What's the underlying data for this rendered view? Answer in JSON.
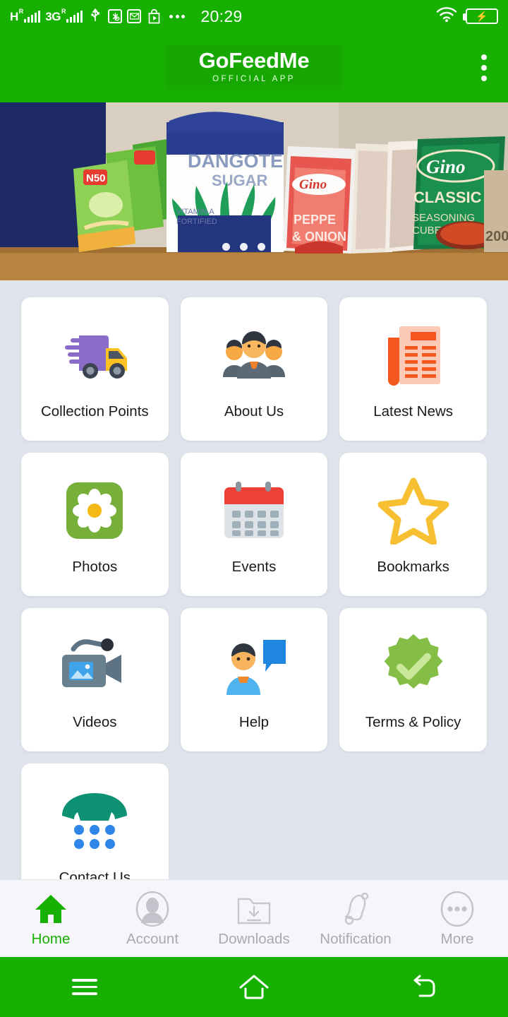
{
  "theme": {
    "brand_green": "#17b000",
    "page_bg": "#dfe3ec",
    "tile_bg": "#ffffff",
    "nav_bg": "#f6f6fa",
    "inactive_grey": "#a9a9b4"
  },
  "status_bar": {
    "time": "20:29",
    "network_1": {
      "label": "H",
      "roaming": "R"
    },
    "network_2": {
      "label": "3G",
      "roaming": "R"
    },
    "icons": [
      "usb-icon",
      "settings-icon",
      "mail-icon",
      "play-store-icon",
      "overflow-dots-icon",
      "wifi-icon",
      "battery-charging-icon"
    ]
  },
  "app_bar": {
    "title": "GoFeedMe",
    "subtitle": "OFFICIAL APP",
    "overflow_menu": "overflow-menu-icon"
  },
  "banner": {
    "alt": "Assorted Nigerian grocery food items: Power Oil sachets, Dangote Sugar bag, Gino pepper and onion sachets, Gino Classic seasoning cubes",
    "slide_count": 4,
    "active_slide": 4
  },
  "grid": {
    "items": [
      {
        "label": "Collection Points",
        "icon": "delivery-truck-icon"
      },
      {
        "label": "About Us",
        "icon": "people-group-icon"
      },
      {
        "label": "Latest News",
        "icon": "newspaper-icon"
      },
      {
        "label": "Photos",
        "icon": "flower-photo-icon"
      },
      {
        "label": "Events",
        "icon": "calendar-icon"
      },
      {
        "label": "Bookmarks",
        "icon": "star-icon"
      },
      {
        "label": "Videos",
        "icon": "video-camera-icon"
      },
      {
        "label": "Help",
        "icon": "person-speech-bubble-icon"
      },
      {
        "label": "Terms & Policy",
        "icon": "verified-badge-icon"
      },
      {
        "label": "Contact Us",
        "icon": "telephone-dialpad-icon"
      }
    ]
  },
  "bottom_nav": {
    "items": [
      {
        "label": "Home",
        "icon": "home-icon",
        "active": true
      },
      {
        "label": "Account",
        "icon": "account-avatar-icon",
        "active": false
      },
      {
        "label": "Downloads",
        "icon": "download-folder-icon",
        "active": false
      },
      {
        "label": "Notification",
        "icon": "bell-icon",
        "active": false
      },
      {
        "label": "More",
        "icon": "more-dots-icon",
        "active": false
      }
    ]
  },
  "system_nav": {
    "items": [
      {
        "icon": "recent-apps-icon"
      },
      {
        "icon": "home-outline-icon"
      },
      {
        "icon": "back-arrow-icon"
      }
    ]
  }
}
